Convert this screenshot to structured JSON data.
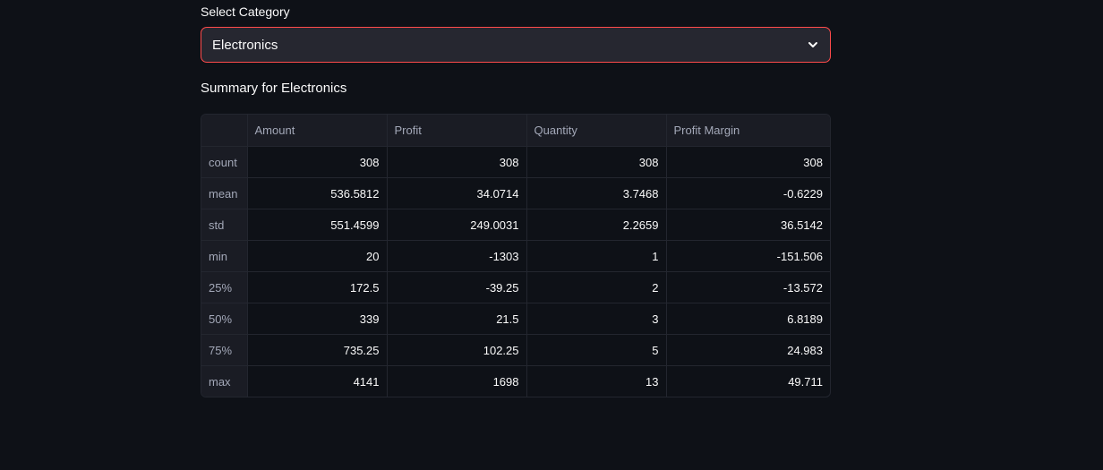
{
  "select": {
    "label": "Select Category",
    "value": "Electronics"
  },
  "summary": {
    "title": "Summary for Electronics"
  },
  "table": {
    "columns": [
      "",
      "Amount",
      "Profit",
      "Quantity",
      "Profit Margin"
    ],
    "rows": [
      {
        "index": "count",
        "values": [
          "308",
          "308",
          "308",
          "308"
        ]
      },
      {
        "index": "mean",
        "values": [
          "536.5812",
          "34.0714",
          "3.7468",
          "-0.6229"
        ]
      },
      {
        "index": "std",
        "values": [
          "551.4599",
          "249.0031",
          "2.2659",
          "36.5142"
        ]
      },
      {
        "index": "min",
        "values": [
          "20",
          "-1303",
          "1",
          "-151.506"
        ]
      },
      {
        "index": "25%",
        "values": [
          "172.5",
          "-39.25",
          "2",
          "-13.572"
        ]
      },
      {
        "index": "50%",
        "values": [
          "339",
          "21.5",
          "3",
          "6.8189"
        ]
      },
      {
        "index": "75%",
        "values": [
          "735.25",
          "102.25",
          "5",
          "24.983"
        ]
      },
      {
        "index": "max",
        "values": [
          "4141",
          "1698",
          "13",
          "49.711"
        ]
      }
    ]
  },
  "colors": {
    "background": "#0e1117",
    "select_border_focus": "#ff4b4b",
    "select_background": "#262730",
    "header_background": "#1a1c24"
  },
  "icons": {
    "dropdown": "chevron-down-icon"
  }
}
